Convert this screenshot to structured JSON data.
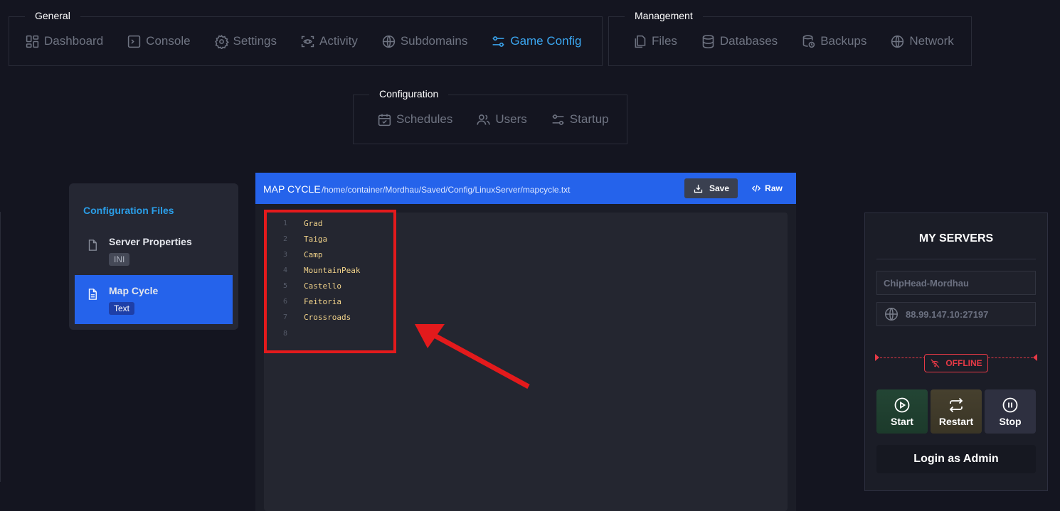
{
  "nav": {
    "general": {
      "title": "General",
      "items": [
        {
          "label": "Dashboard",
          "icon": "dashboard-icon"
        },
        {
          "label": "Console",
          "icon": "terminal-icon"
        },
        {
          "label": "Settings",
          "icon": "gear-icon"
        },
        {
          "label": "Activity",
          "icon": "activity-icon"
        },
        {
          "label": "Subdomains",
          "icon": "globe-icon"
        },
        {
          "label": "Game Config",
          "icon": "sliders-icon",
          "active": true
        }
      ]
    },
    "management": {
      "title": "Management",
      "items": [
        {
          "label": "Files",
          "icon": "files-icon"
        },
        {
          "label": "Databases",
          "icon": "database-icon"
        },
        {
          "label": "Backups",
          "icon": "backup-icon"
        },
        {
          "label": "Network",
          "icon": "globe-icon"
        }
      ]
    },
    "configuration": {
      "title": "Configuration",
      "items": [
        {
          "label": "Schedules",
          "icon": "calendar-icon"
        },
        {
          "label": "Users",
          "icon": "users-icon"
        },
        {
          "label": "Startup",
          "icon": "sliders-icon"
        }
      ]
    }
  },
  "sidebar": {
    "title": "Configuration Files",
    "files": [
      {
        "name": "Server Properties",
        "tag": "INI",
        "icon": "file-icon"
      },
      {
        "name": "Map Cycle",
        "tag": "Text",
        "icon": "file-text-icon",
        "selected": true
      }
    ]
  },
  "editor": {
    "title": "MAP CYCLE",
    "path": "/home/container/Mordhau/Saved/Config/LinuxServer/mapcycle.txt",
    "save_label": "Save",
    "raw_label": "Raw",
    "lines": [
      {
        "num": "1",
        "text": "Grad"
      },
      {
        "num": "2",
        "text": "Taiga"
      },
      {
        "num": "3",
        "text": "Camp"
      },
      {
        "num": "4",
        "text": "MountainPeak"
      },
      {
        "num": "5",
        "text": "Castello"
      },
      {
        "num": "6",
        "text": "Feitoria"
      },
      {
        "num": "7",
        "text": "Crossroads"
      },
      {
        "num": "8",
        "text": ""
      }
    ]
  },
  "servers": {
    "title": "MY SERVERS",
    "server_name": "ChipHead-Mordhau",
    "address": "88.99.147.10:27197",
    "status": "OFFLINE",
    "start_label": "Start",
    "restart_label": "Restart",
    "stop_label": "Stop",
    "login_label": "Login as Admin"
  },
  "colors": {
    "accent": "#2563eb",
    "active_nav": "#3ba6f0",
    "offline": "#e63946",
    "annotation": "#e31a1c"
  }
}
